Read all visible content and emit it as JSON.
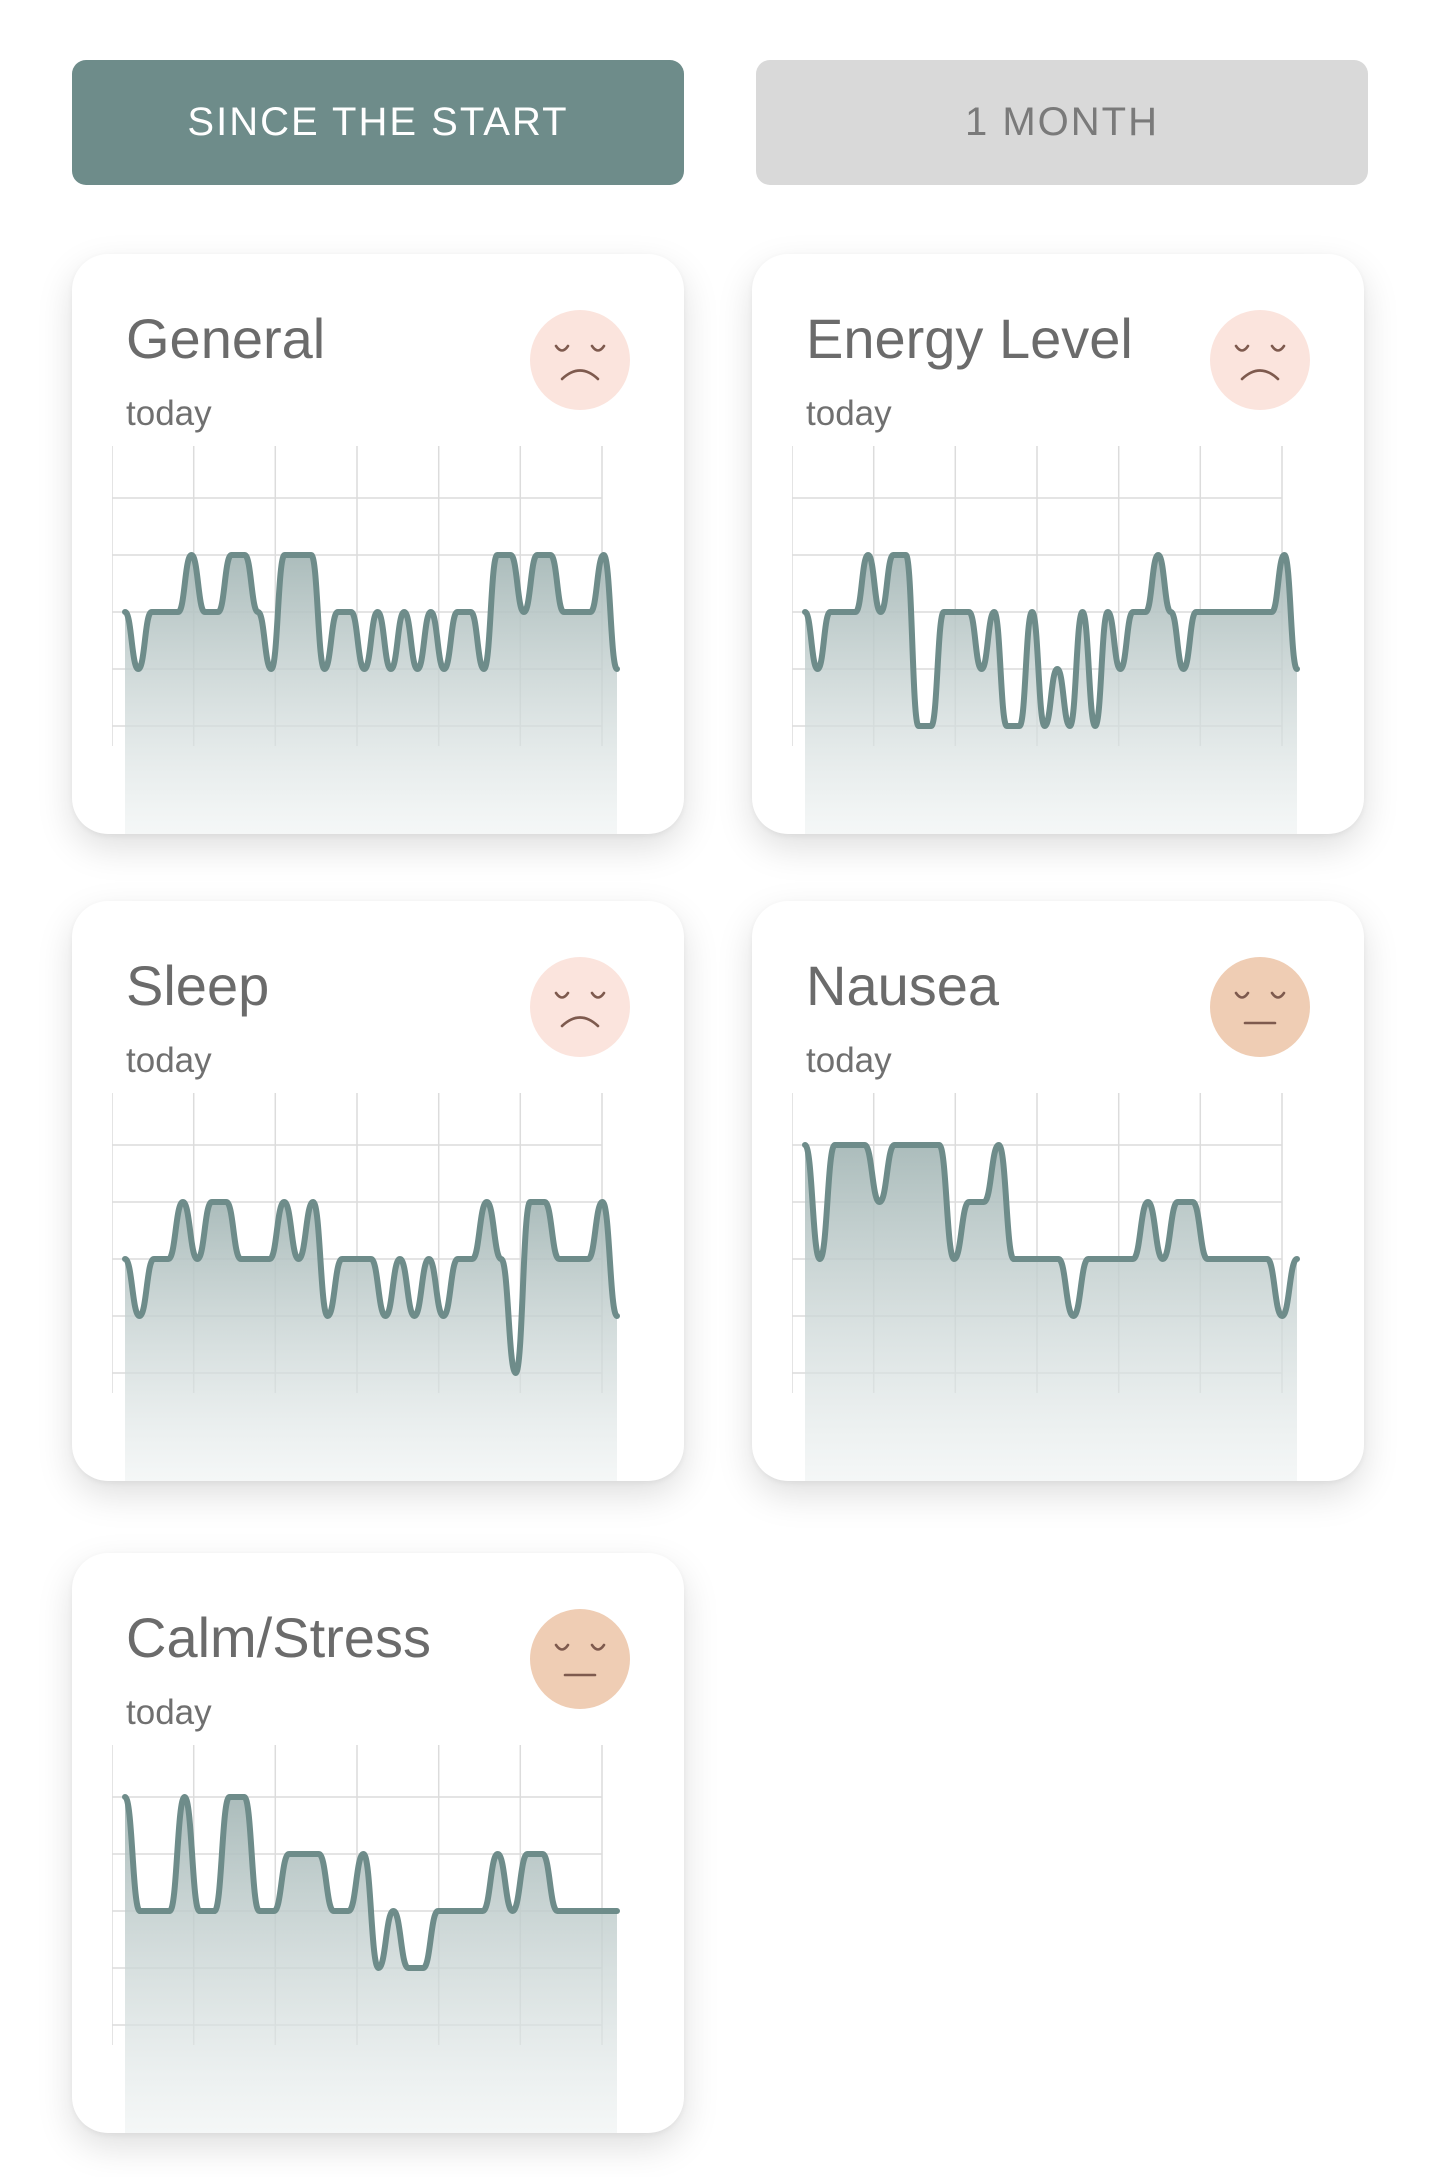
{
  "tabs": {
    "since_start": "SINCE THE START",
    "one_month": "1 MONTH"
  },
  "colors": {
    "accent": "#6e8c8a",
    "tab_inactive_bg": "#d9d9d9",
    "sad_face_bg": "#fbe4dd",
    "neutral_face_bg": "#efcdb4",
    "face_feature": "#7e5a4e"
  },
  "cards": [
    {
      "title": "General",
      "subtitle": "today",
      "mood": "sad",
      "icon": "sad-face-icon",
      "chart_data": {
        "type": "area",
        "levels": 5,
        "values": [
          4,
          3,
          4,
          4,
          4,
          5,
          4,
          4,
          5,
          5,
          4,
          3,
          5,
          5,
          5,
          3,
          4,
          4,
          3,
          4,
          3,
          4,
          3,
          4,
          3,
          4,
          4,
          3,
          5,
          5,
          4,
          5,
          5,
          4,
          4,
          4,
          5,
          3
        ]
      }
    },
    {
      "title": "Energy Level",
      "subtitle": "today",
      "mood": "sad",
      "icon": "sad-face-icon",
      "chart_data": {
        "type": "area",
        "levels": 5,
        "values": [
          4,
          3,
          4,
          4,
          4,
          5,
          4,
          5,
          5,
          2,
          2,
          4,
          4,
          4,
          3,
          4,
          2,
          2,
          4,
          2,
          3,
          2,
          4,
          2,
          4,
          3,
          4,
          4,
          5,
          4,
          3,
          4,
          4,
          4,
          4,
          4,
          4,
          4,
          5,
          3
        ]
      }
    },
    {
      "title": "Sleep",
      "subtitle": "today",
      "mood": "sad",
      "icon": "sad-face-icon",
      "chart_data": {
        "type": "area",
        "levels": 5,
        "values": [
          4,
          3,
          4,
          4,
          5,
          4,
          5,
          5,
          4,
          4,
          4,
          5,
          4,
          5,
          3,
          4,
          4,
          4,
          3,
          4,
          3,
          4,
          3,
          4,
          4,
          5,
          4,
          2,
          5,
          5,
          4,
          4,
          4,
          5,
          3
        ]
      }
    },
    {
      "title": "Nausea",
      "subtitle": "today",
      "mood": "neutral",
      "icon": "neutral-face-icon",
      "chart_data": {
        "type": "area",
        "levels": 5,
        "values": [
          6,
          4,
          6,
          6,
          6,
          5,
          6,
          6,
          6,
          6,
          4,
          5,
          5,
          6,
          4,
          4,
          4,
          4,
          3,
          4,
          4,
          4,
          4,
          5,
          4,
          5,
          5,
          4,
          4,
          4,
          4,
          4,
          3,
          4
        ]
      }
    },
    {
      "title": "Calm/Stress",
      "subtitle": "today",
      "mood": "neutral",
      "icon": "neutral-face-icon",
      "chart_data": {
        "type": "area",
        "levels": 5,
        "values": [
          6,
          4,
          4,
          4,
          6,
          4,
          4,
          6,
          6,
          4,
          4,
          5,
          5,
          5,
          4,
          4,
          5,
          3,
          4,
          3,
          3,
          4,
          4,
          4,
          4,
          5,
          4,
          5,
          5,
          4,
          4,
          4,
          4,
          4
        ]
      }
    }
  ]
}
